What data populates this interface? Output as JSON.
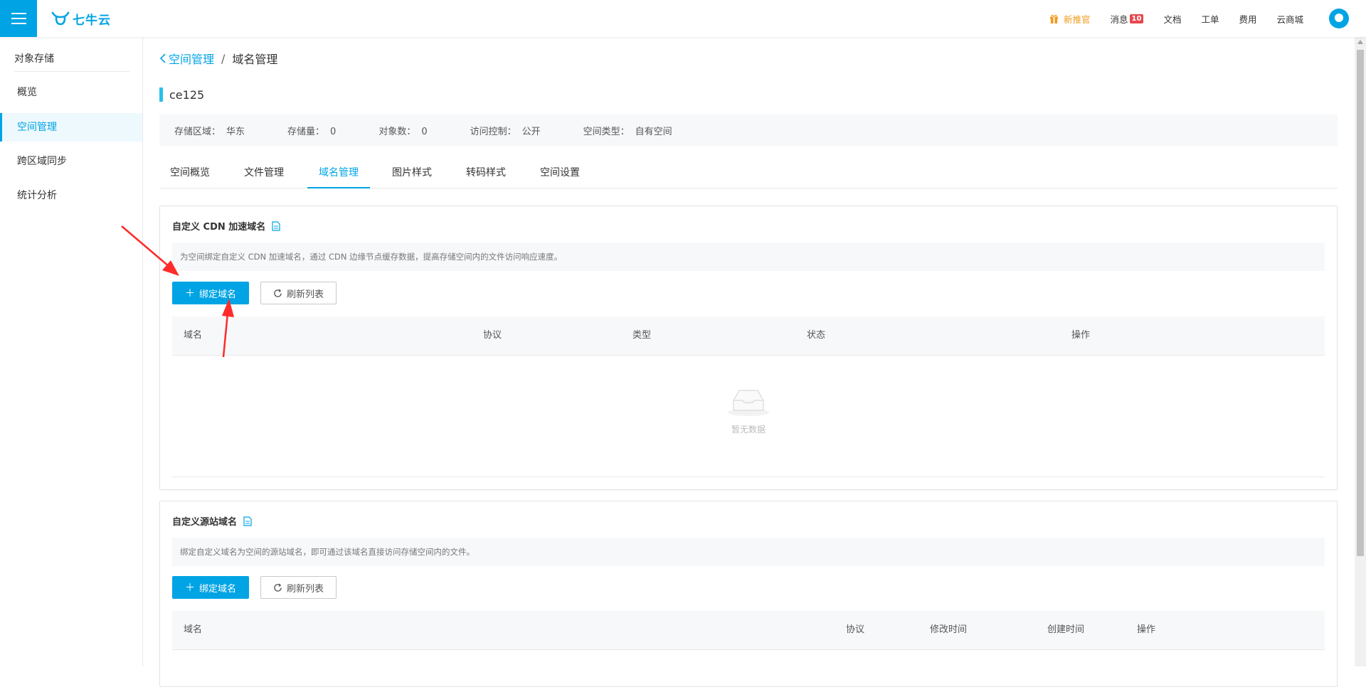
{
  "header": {
    "logo_text": "七牛云",
    "nav": {
      "new_user": "新推官",
      "messages": "消息",
      "messages_badge": "10",
      "docs": "文档",
      "ticket": "工单",
      "billing": "费用",
      "market": "云商城"
    }
  },
  "sidebar": {
    "title": "对象存储",
    "items": [
      {
        "label": "概览"
      },
      {
        "label": "空间管理"
      },
      {
        "label": "跨区域同步"
      },
      {
        "label": "统计分析"
      }
    ]
  },
  "breadcrumb": {
    "parent": "空间管理",
    "separator": "/",
    "current": "域名管理"
  },
  "bucket": {
    "name": "ce125",
    "info": [
      {
        "label": "存储区域：",
        "value": "华东"
      },
      {
        "label": "存储量：",
        "value": "0"
      },
      {
        "label": "对象数：",
        "value": "0"
      },
      {
        "label": "访问控制：",
        "value": "公开"
      },
      {
        "label": "空间类型：",
        "value": "自有空间"
      }
    ]
  },
  "tabs": [
    {
      "label": "空间概览"
    },
    {
      "label": "文件管理"
    },
    {
      "label": "域名管理"
    },
    {
      "label": "图片样式"
    },
    {
      "label": "转码样式"
    },
    {
      "label": "空间设置"
    }
  ],
  "cdn_section": {
    "title": "自定义 CDN 加速域名",
    "description": "为空间绑定自定义 CDN 加速域名，通过 CDN 边缘节点缓存数据，提高存储空间内的文件访问响应速度。",
    "bind_button": "绑定域名",
    "refresh_button": "刷新列表",
    "columns": [
      "域名",
      "协议",
      "类型",
      "状态",
      "操作"
    ],
    "empty_text": "暂无数据"
  },
  "origin_section": {
    "title": "自定义源站域名",
    "description": "绑定自定义域名为空间的源站域名，即可通过该域名直接访问存储空间内的文件。",
    "bind_button": "绑定域名",
    "refresh_button": "刷新列表",
    "columns": [
      "域名",
      "协议",
      "修改时间",
      "创建时间",
      "操作"
    ]
  },
  "colors": {
    "accent": "#00a4e4",
    "title_bar": "#25c1e8",
    "new_user": "#f29b1c",
    "badge": "#e5484d",
    "annotation_arrow": "#ff2a2a"
  }
}
